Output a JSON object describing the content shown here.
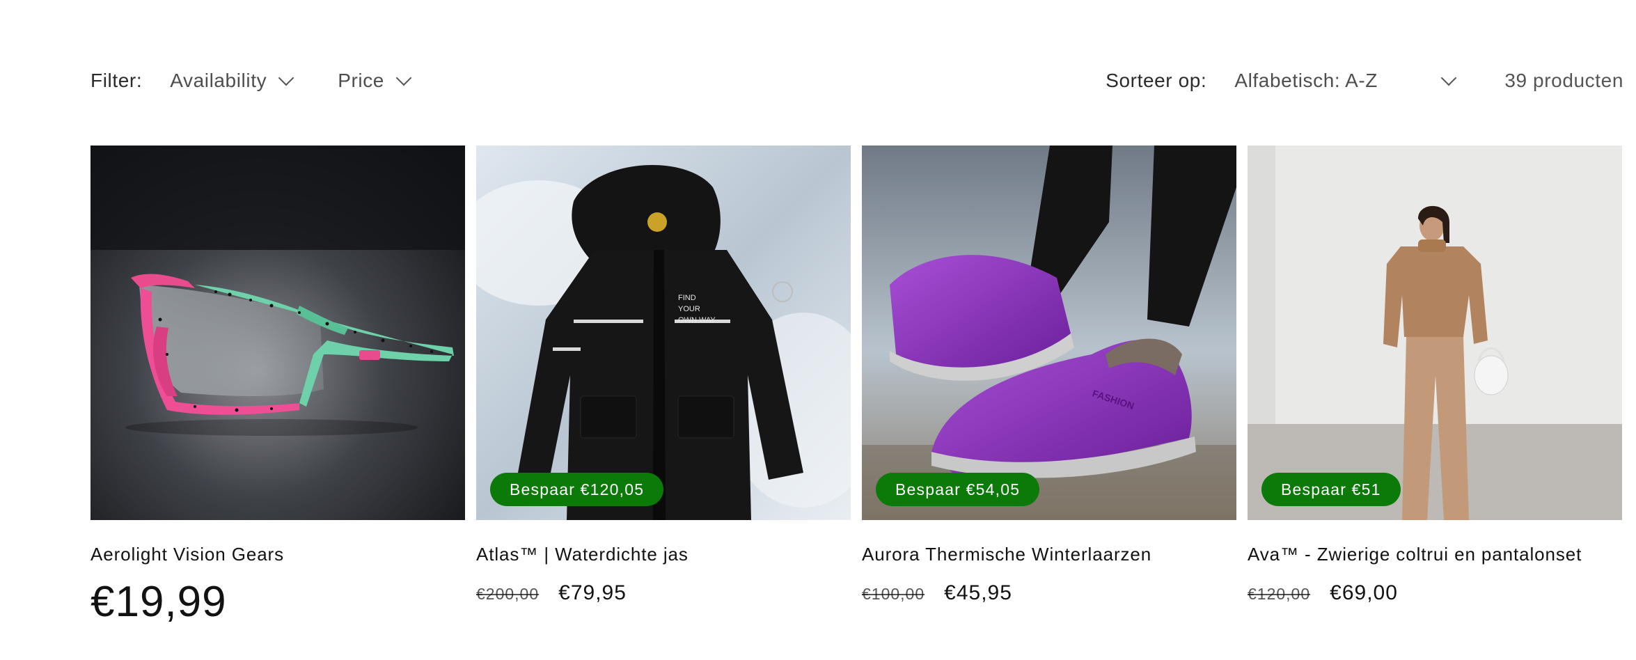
{
  "facets": {
    "filter_label": "Filter:",
    "filters": [
      "Availability",
      "Price"
    ],
    "sort_label": "Sorteer op:",
    "sort_value": "Alfabetisch: A-Z",
    "product_count": "39 producten"
  },
  "products": [
    {
      "title": "Aerolight Vision Gears",
      "price": "€19,99",
      "image": "cycling-sunglasses-image"
    },
    {
      "title": "Atlas™ | Waterdichte jas",
      "badge": "Bespaar €120,05",
      "compare_price": "€200,00",
      "price": "€79,95",
      "image": "black-jacket-image",
      "image_text": [
        "FIND",
        "YOUR",
        "OWN WAY"
      ]
    },
    {
      "title": "Aurora Thermische Winterlaarzen",
      "badge": "Bespaar €54,05",
      "compare_price": "€100,00",
      "price": "€45,95",
      "image": "purple-boots-image",
      "image_text": [
        "FASHION"
      ]
    },
    {
      "title": "Ava™ - Zwierige coltrui en pantalonset",
      "badge": "Bespaar €51",
      "compare_price": "€120,00",
      "price": "€69,00",
      "image": "beige-outfit-image"
    }
  ],
  "colors": {
    "badge_bg": "#0b7a08",
    "text": "#121212"
  }
}
